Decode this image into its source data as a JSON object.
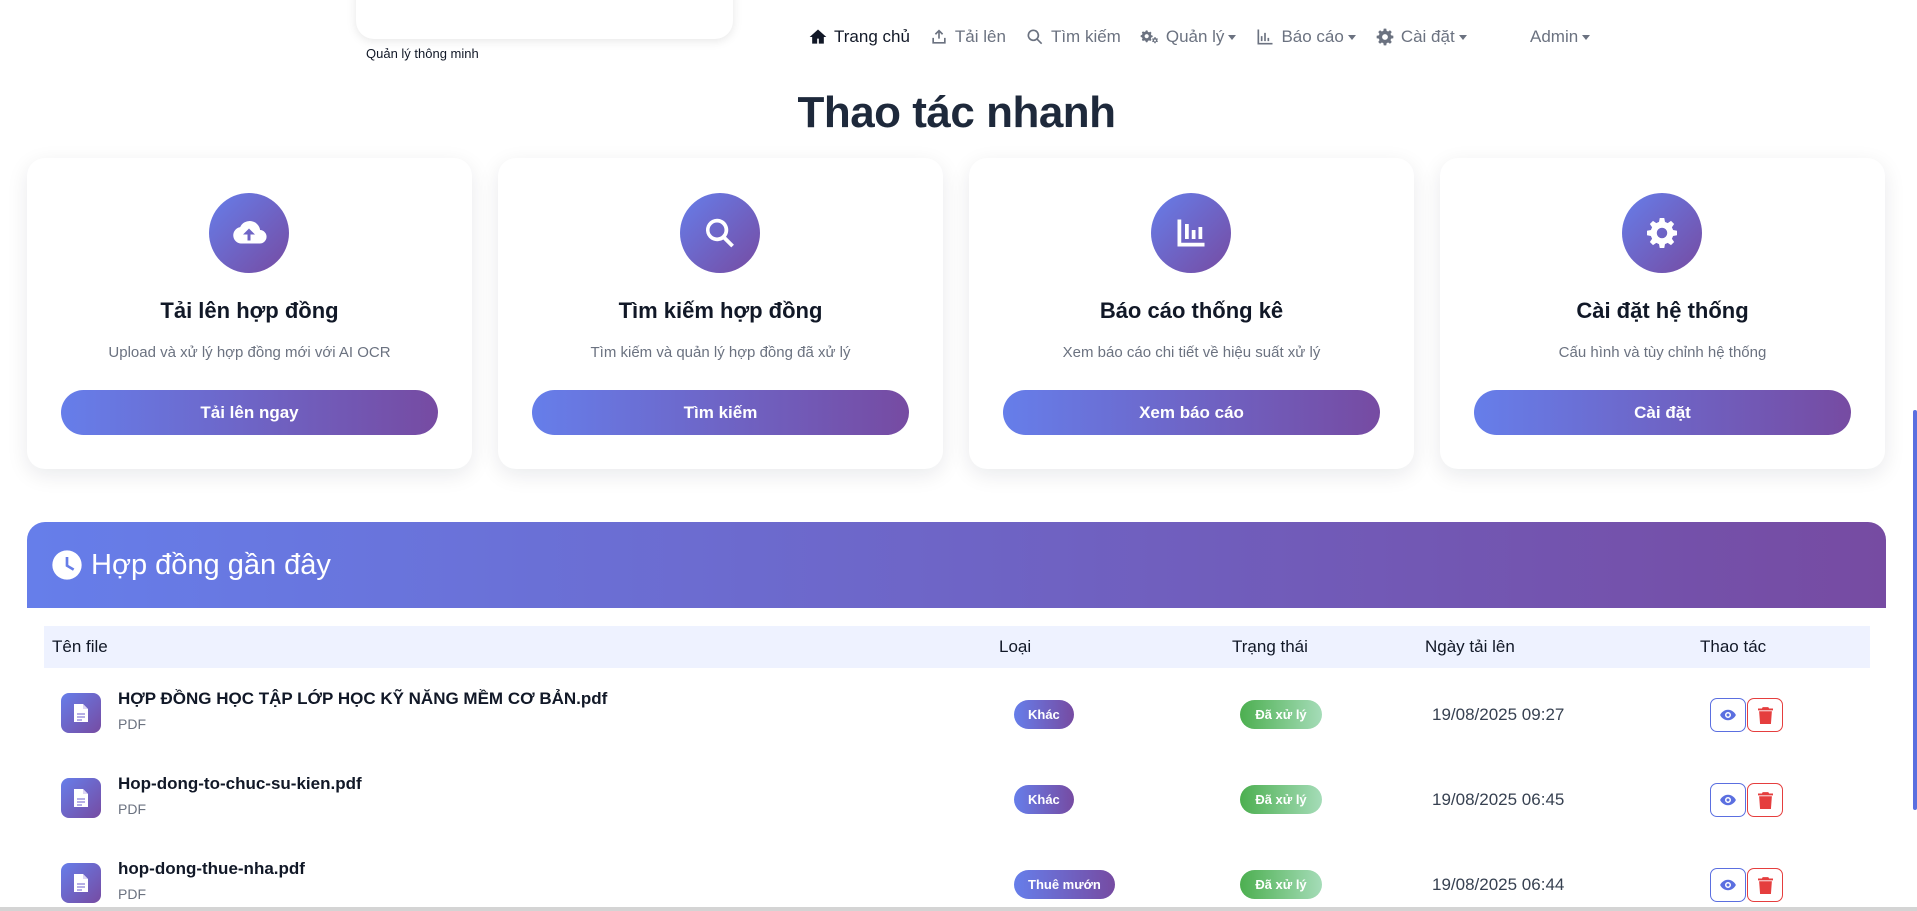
{
  "brand": {
    "subtitle": "Quản lý thông minh"
  },
  "nav": {
    "items": [
      {
        "label": "Trang chủ",
        "icon": "home-icon",
        "active": true,
        "dropdown": false
      },
      {
        "label": "Tải lên",
        "icon": "upload-icon",
        "active": false,
        "dropdown": false
      },
      {
        "label": "Tìm kiếm",
        "icon": "search-icon",
        "active": false,
        "dropdown": false
      },
      {
        "label": "Quản lý",
        "icon": "cogs-icon",
        "active": false,
        "dropdown": true
      },
      {
        "label": "Báo cáo",
        "icon": "chart-icon",
        "active": false,
        "dropdown": true
      },
      {
        "label": "Cài đặt",
        "icon": "gear-icon",
        "active": false,
        "dropdown": true
      }
    ],
    "user": "Admin"
  },
  "quick_actions": {
    "title": "Thao tác nhanh",
    "cards": [
      {
        "title": "Tải lên hợp đồng",
        "description": "Upload và xử lý hợp đồng mới với AI OCR",
        "button": "Tải lên ngay",
        "icon": "cloud-upload-icon"
      },
      {
        "title": "Tìm kiếm hợp đồng",
        "description": "Tìm kiếm và quản lý hợp đồng đã xử lý",
        "button": "Tìm kiếm",
        "icon": "search-icon"
      },
      {
        "title": "Báo cáo thống kê",
        "description": "Xem báo cáo chi tiết về hiệu suất xử lý",
        "button": "Xem báo cáo",
        "icon": "bar-chart-icon"
      },
      {
        "title": "Cài đặt hệ thống",
        "description": "Cấu hình và tùy chỉnh hệ thống",
        "button": "Cài đặt",
        "icon": "gear-icon"
      }
    ]
  },
  "recent": {
    "title": "Hợp đồng gần đây",
    "columns": {
      "file": "Tên file",
      "type": "Loại",
      "status": "Trạng thái",
      "date": "Ngày tải lên",
      "actions": "Thao tác"
    },
    "rows": [
      {
        "name": "HỢP ĐỒNG HỌC TẬP LỚP HỌC KỸ NĂNG MỀM CƠ BẢN.pdf",
        "ext": "PDF",
        "type": "Khác",
        "status": "Đã xử lý",
        "date": "19/08/2025 09:27"
      },
      {
        "name": "Hop-dong-to-chuc-su-kien.pdf",
        "ext": "PDF",
        "type": "Khác",
        "status": "Đã xử lý",
        "date": "19/08/2025 06:45"
      },
      {
        "name": "hop-dong-thue-nha.pdf",
        "ext": "PDF",
        "type": "Thuê mướn",
        "status": "Đã xử lý",
        "date": "19/08/2025 06:44"
      }
    ]
  },
  "colors": {
    "accent_start": "#667eea",
    "accent_end": "#764ba2",
    "success": "#4caf50",
    "danger": "#e53e3e"
  }
}
